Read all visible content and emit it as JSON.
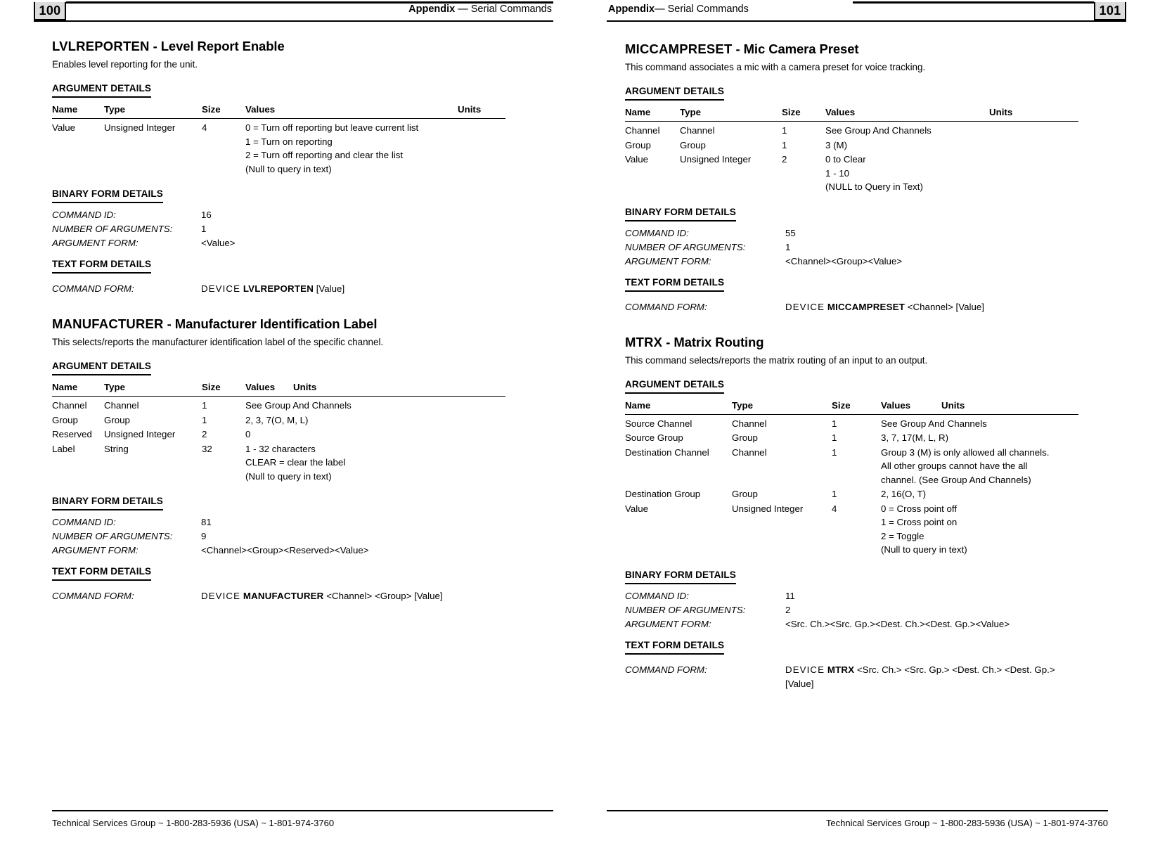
{
  "document": {
    "type": "appendix-serial-commands-spread"
  },
  "pages": [
    {
      "number": "100",
      "header": {
        "bold": "Appendix",
        "rest": " — Serial Commands"
      },
      "footer": "Technical Services Group ~ 1-800-283-5936 (USA) ~ 1-801-974-3760",
      "commands": [
        {
          "code": "LVLREPORTEN",
          "dash": " - ",
          "title": "Level Report Enable",
          "description": "Enables level reporting for the unit.",
          "argument_details_heading": "ARGUMENT DETAILS",
          "table": {
            "headers": [
              "Name",
              "Type",
              "Size",
              "Values",
              "Units"
            ],
            "col_layout": "wide-units",
            "rows": [
              {
                "name": "Value",
                "type": "Unsigned Integer",
                "size": "4",
                "values": [
                  "0 = Turn off reporting but leave current list",
                  "1 = Turn on reporting",
                  "2 = Turn off reporting and clear the list",
                  "(Null to query in text)"
                ],
                "units": ""
              }
            ]
          },
          "binary_heading": "BINARY FORM DETAILS",
          "binary": [
            {
              "key": "COMMAND ID:",
              "value": "16"
            },
            {
              "key": "NUMBER OF ARGUMENTS:",
              "value": "1"
            },
            {
              "key": "ARGUMENT FORM:",
              "value": "<Value>"
            }
          ],
          "text_heading": "TEXT FORM DETAILS",
          "text_form": {
            "key": "COMMAND FORM:",
            "device": "DEVICE",
            "name": "LVLREPORTEN",
            "args": "[Value]",
            "args_line2": ""
          }
        },
        {
          "code": "MANUFACTURER",
          "dash": " - ",
          "title": "Manufacturer Identification Label",
          "description": "This selects/reports the manufacturer identification label of the specific channel.",
          "argument_details_heading": "ARGUMENT DETAILS",
          "table": {
            "headers": [
              "Name",
              "Type",
              "Size",
              "Values",
              "Units"
            ],
            "col_layout": "narrow-units",
            "rows": [
              {
                "name": "Channel",
                "type": "Channel",
                "size": "1",
                "values": [
                  "See Group And Channels"
                ],
                "units": ""
              },
              {
                "name": "Group",
                "type": "Group",
                "size": "1",
                "values": [
                  "2, 3, 7(O, M, L)"
                ],
                "units": ""
              },
              {
                "name": "Reserved",
                "type": "Unsigned Integer",
                "size": "2",
                "values": [
                  "0"
                ],
                "units": ""
              },
              {
                "name": "Label",
                "type": "String",
                "size": "32",
                "values": [
                  "1 - 32 characters",
                  "CLEAR = clear the label",
                  "(Null to query in text)"
                ],
                "units": ""
              }
            ]
          },
          "binary_heading": "BINARY FORM DETAILS",
          "binary": [
            {
              "key": "COMMAND ID:",
              "value": "81"
            },
            {
              "key": "NUMBER OF ARGUMENTS:",
              "value": "9"
            },
            {
              "key": "ARGUMENT FORM:",
              "value": "<Channel><Group><Reserved><Value>"
            }
          ],
          "text_heading": "TEXT FORM DETAILS",
          "text_form": {
            "key": "COMMAND FORM:",
            "device": "DEVICE",
            "name": "MANUFACTURER",
            "args": "<Channel> <Group> [Value]",
            "args_line2": ""
          }
        }
      ]
    },
    {
      "number": "101",
      "header": {
        "bold": "Appendix",
        "rest": "— Serial Commands"
      },
      "footer": "Technical Services Group ~ 1-800-283-5936 (USA) ~ 1-801-974-3760",
      "commands": [
        {
          "code": "MICCAMPRESET",
          "dash": " - ",
          "title": "Mic Camera Preset",
          "description": "This command associates a mic with a camera preset for voice tracking.",
          "argument_details_heading": "ARGUMENT DETAILS",
          "table": {
            "headers": [
              "Name",
              "Type",
              "Size",
              "Values",
              "Units"
            ],
            "col_layout": "wide-units",
            "rows": [
              {
                "name": "Channel",
                "type": "Channel",
                "size": "1",
                "values": [
                  "See Group And Channels"
                ],
                "units": ""
              },
              {
                "name": "Group",
                "type": "Group",
                "size": "1",
                "values": [
                  "3 (M)"
                ],
                "units": ""
              },
              {
                "name": "Value",
                "type": "Unsigned Integer",
                "size": "2",
                "values": [
                  "0 to Clear",
                  "1 - 10",
                  "(NULL to Query in Text)"
                ],
                "units": ""
              }
            ]
          },
          "binary_heading": "BINARY FORM DETAILS",
          "binary": [
            {
              "key": "COMMAND ID:",
              "value": "55"
            },
            {
              "key": "NUMBER OF ARGUMENTS:",
              "value": "1"
            },
            {
              "key": "ARGUMENT FORM:",
              "value": "<Channel><Group><Value>"
            }
          ],
          "text_heading": "TEXT FORM DETAILS",
          "text_form": {
            "key": "COMMAND FORM:",
            "device": "DEVICE",
            "name": "MICCAMPRESET",
            "args": "<Channel> [Value]",
            "args_line2": ""
          }
        },
        {
          "code": "MTRX",
          "dash": " - ",
          "title": "Matrix Routing",
          "description": "This command selects/reports the matrix routing of an input to an output.",
          "argument_details_heading": "ARGUMENT DETAILS",
          "table": {
            "headers": [
              "Name",
              "Type",
              "Size",
              "Values",
              "Units"
            ],
            "col_layout": "mtrx",
            "rows": [
              {
                "name": "Source Channel",
                "type": "Channel",
                "size": "1",
                "values": [
                  "See Group And Channels"
                ],
                "units": ""
              },
              {
                "name": "Source Group",
                "type": "Group",
                "size": "1",
                "values": [
                  "3, 7, 17(M, L, R)"
                ],
                "units": ""
              },
              {
                "name": "Destination Channel",
                "type": "Channel",
                "size": "1",
                "values": [
                  "Group 3 (M) is only allowed all channels.",
                  "All other groups cannot have the all",
                  "channel. (See Group And Channels)"
                ],
                "units": ""
              },
              {
                "name": "Destination Group",
                "type": "Group",
                "size": "1",
                "values": [
                  "2, 16(O, T)"
                ],
                "units": ""
              },
              {
                "name": "Value",
                "type": "Unsigned Integer",
                "size": "4",
                "values": [
                  "0 = Cross point off",
                  "1 = Cross point on",
                  "2 = Toggle",
                  "(Null to query in text)"
                ],
                "units": ""
              }
            ]
          },
          "binary_heading": "BINARY FORM DETAILS",
          "binary": [
            {
              "key": "COMMAND ID:",
              "value": "11"
            },
            {
              "key": "NUMBER OF ARGUMENTS:",
              "value": "2"
            },
            {
              "key": "ARGUMENT FORM:",
              "value": "<Src. Ch.><Src. Gp.><Dest. Ch.><Dest. Gp.><Value>"
            }
          ],
          "text_heading": "TEXT FORM DETAILS",
          "text_form": {
            "key": "COMMAND FORM:",
            "device": "DEVICE",
            "name": "MTRX",
            "args": "<Src. Ch.> <Src. Gp.> <Dest. Ch.> <Dest. Gp.>",
            "args_line2": "[Value]"
          }
        }
      ]
    }
  ]
}
